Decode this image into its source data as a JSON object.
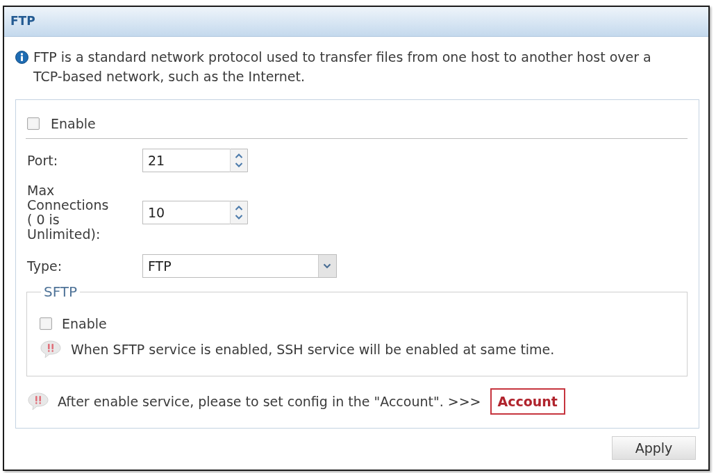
{
  "panel": {
    "title": "FTP"
  },
  "description": {
    "text": "FTP is a standard network protocol used to transfer files from one host to another host over a TCP-based network, such as the Internet."
  },
  "enable": {
    "label": "Enable",
    "checked": false
  },
  "fields": [
    {
      "kind": "spinner",
      "label": "Port:",
      "value": "21"
    },
    {
      "kind": "spinner",
      "label": "Max Connections ( 0 is Unlimited):",
      "value": "10"
    },
    {
      "kind": "select",
      "label": "Type:",
      "value": "FTP"
    }
  ],
  "sftp": {
    "legend": "SFTP",
    "enable": {
      "label": "Enable",
      "checked": false
    },
    "note": "When SFTP service is enabled, SSH service will be enabled at same time."
  },
  "account_note": {
    "text": "After enable service, please to set config in the \"Account\". >>>",
    "link": "Account"
  },
  "buttons": [
    {
      "label": "Apply"
    }
  ]
}
